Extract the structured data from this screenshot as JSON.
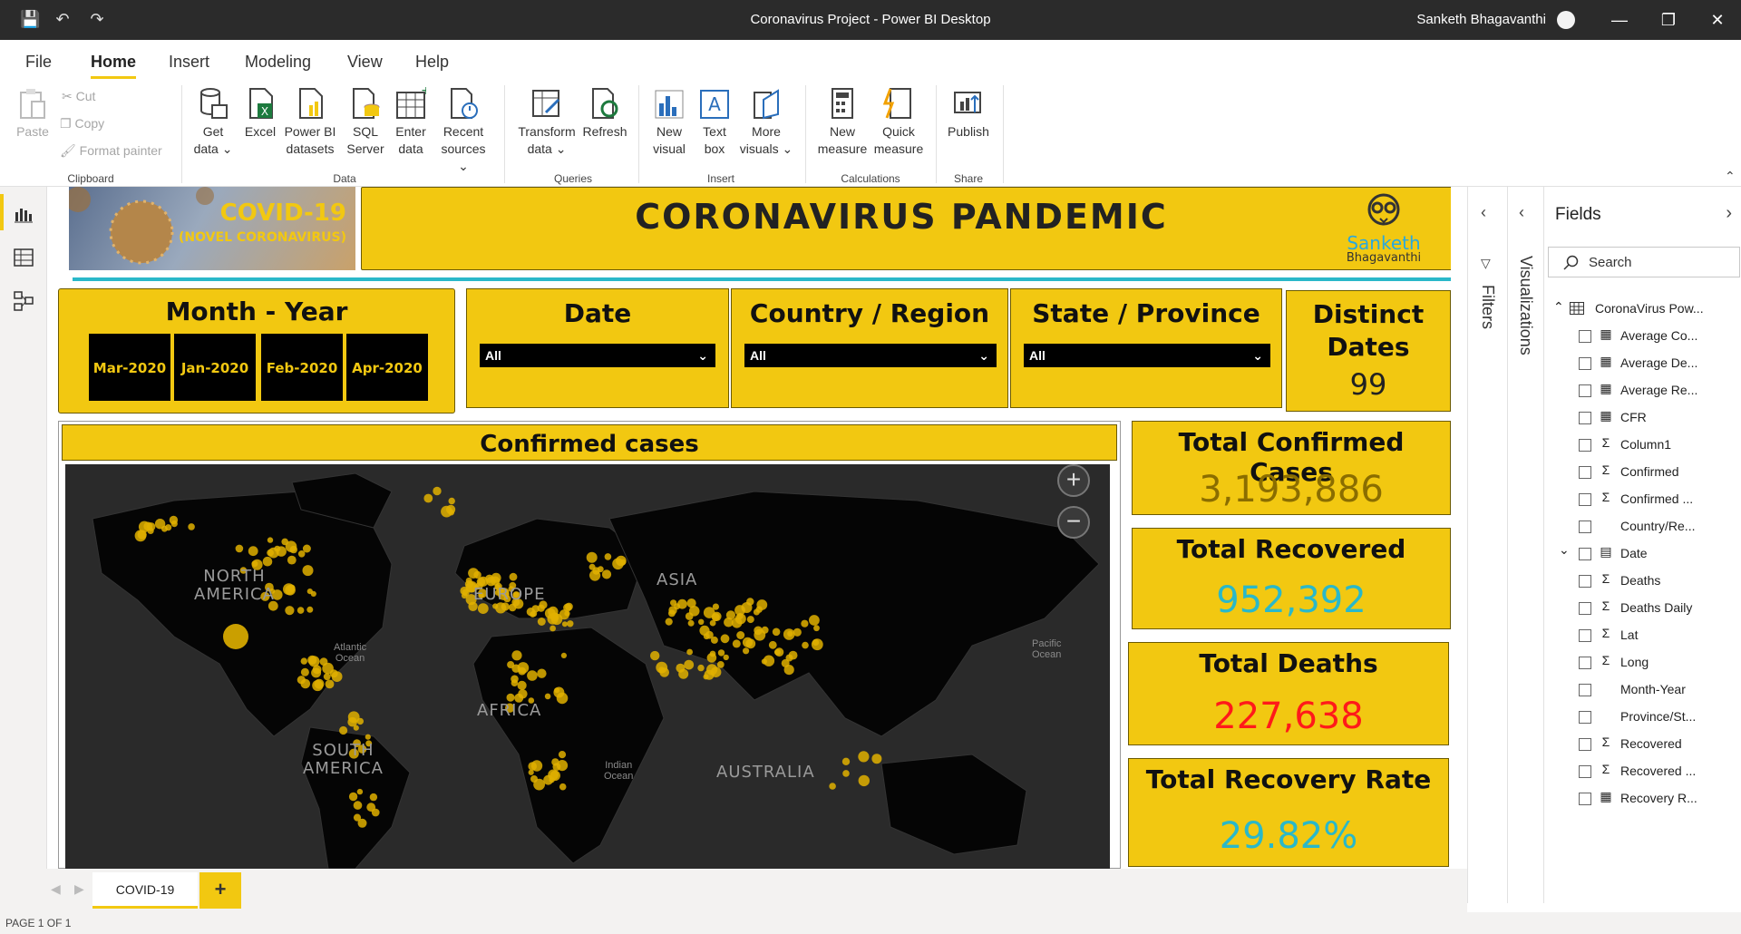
{
  "window": {
    "title": "Coronavirus Project - Power BI Desktop",
    "user": "Sanketh Bhagavanthi"
  },
  "menu": {
    "items": [
      "File",
      "Home",
      "Insert",
      "Modeling",
      "View",
      "Help"
    ],
    "active": "Home"
  },
  "ribbon": {
    "clipboard": {
      "paste": "Paste",
      "cut": "Cut",
      "copy": "Copy",
      "format_painter": "Format painter",
      "group": "Clipboard"
    },
    "data": {
      "get_data": [
        "Get",
        "data ⌄"
      ],
      "excel": "Excel",
      "powerbi_datasets": [
        "Power BI",
        "datasets"
      ],
      "sql_server": [
        "SQL",
        "Server"
      ],
      "enter_data": [
        "Enter",
        "data"
      ],
      "recent_sources": [
        "Recent",
        "sources ⌄"
      ],
      "group": "Data"
    },
    "queries": {
      "transform": [
        "Transform",
        "data ⌄"
      ],
      "refresh": "Refresh",
      "group": "Queries"
    },
    "insert": {
      "new_visual": [
        "New",
        "visual"
      ],
      "text_box": [
        "Text",
        "box"
      ],
      "more_visuals": [
        "More",
        "visuals ⌄"
      ],
      "group": "Insert"
    },
    "calculations": {
      "new_measure": [
        "New",
        "measure"
      ],
      "quick_measure": [
        "Quick",
        "measure"
      ],
      "group": "Calculations"
    },
    "share": {
      "publish": "Publish",
      "group": "Share"
    }
  },
  "report": {
    "banner": {
      "covid_title": "COVID-19",
      "covid_sub": "(NOVEL CORONAVIRUS)",
      "headline": "CORONAVIRUS PANDEMIC",
      "logo_name": "Sanketh",
      "logo_sub": "Bhagavanthi"
    },
    "slicers": {
      "month_year": {
        "title": "Month - Year",
        "tiles": [
          "Mar-2020",
          "Jan-2020",
          "Feb-2020",
          "Apr-2020"
        ]
      },
      "date": {
        "title": "Date",
        "value": "All"
      },
      "country": {
        "title": "Country / Region",
        "value": "All"
      },
      "state": {
        "title": "State / Province",
        "value": "All"
      },
      "distinct_dates": {
        "title_line1": "Distinct",
        "title_line2": "Dates",
        "value": "99"
      }
    },
    "map": {
      "title": "Confirmed cases",
      "labels": {
        "north_america": [
          "NORTH",
          "AMERICA"
        ],
        "europe": "EUROPE",
        "asia": "ASIA",
        "africa": "AFRICA",
        "south_america": [
          "SOUTH",
          "AMERICA"
        ],
        "australia": "AUSTRALIA",
        "atlantic": [
          "Atlantic",
          "Ocean"
        ],
        "indian": [
          "Indian",
          "Ocean"
        ],
        "pacific": [
          "Pacific",
          "Ocean"
        ]
      },
      "zoom_in": "+",
      "zoom_out": "−"
    },
    "cards": [
      {
        "title": "Total Confirmed Cases",
        "value": "3,193,886",
        "color": "#8a6d00"
      },
      {
        "title": "Total Recovered",
        "value": "952,392",
        "color": "#2ab8c9"
      },
      {
        "title": "Total Deaths",
        "value": "227,638",
        "color": "#ff1a1a"
      },
      {
        "title": "Total Recovery Rate",
        "value": "29.82%",
        "color": "#2ab8c9"
      }
    ]
  },
  "panes": {
    "filters": "Filters",
    "visualizations": "Visualizations",
    "fields_title": "Fields",
    "search_placeholder": "Search",
    "table_name": "CoronaVirus Pow...",
    "fields": [
      {
        "name": "Average Co...",
        "icon": "calc"
      },
      {
        "name": "Average De...",
        "icon": "calc"
      },
      {
        "name": "Average Re...",
        "icon": "calc"
      },
      {
        "name": "CFR",
        "icon": "calc"
      },
      {
        "name": "Column1",
        "icon": "sum"
      },
      {
        "name": "Confirmed",
        "icon": "sum"
      },
      {
        "name": "Confirmed ...",
        "icon": "sum"
      },
      {
        "name": "Country/Re...",
        "icon": ""
      },
      {
        "name": "Date",
        "icon": "date"
      },
      {
        "name": "Deaths",
        "icon": "sum"
      },
      {
        "name": "Deaths Daily",
        "icon": "sum"
      },
      {
        "name": "Lat",
        "icon": "sum"
      },
      {
        "name": "Long",
        "icon": "sum"
      },
      {
        "name": "Month-Year",
        "icon": ""
      },
      {
        "name": "Province/St...",
        "icon": ""
      },
      {
        "name": "Recovered",
        "icon": "sum"
      },
      {
        "name": "Recovered ...",
        "icon": "sum"
      },
      {
        "name": "Recovery R...",
        "icon": "calc"
      }
    ]
  },
  "pages": {
    "tab": "COVID-19",
    "add": "+",
    "status": "PAGE 1 OF 1"
  },
  "colors": {
    "accent": "#f2c811",
    "titlebar": "#2b2b2b",
    "map_bg": "#2a2a2a",
    "bubble": "#e0b000"
  }
}
